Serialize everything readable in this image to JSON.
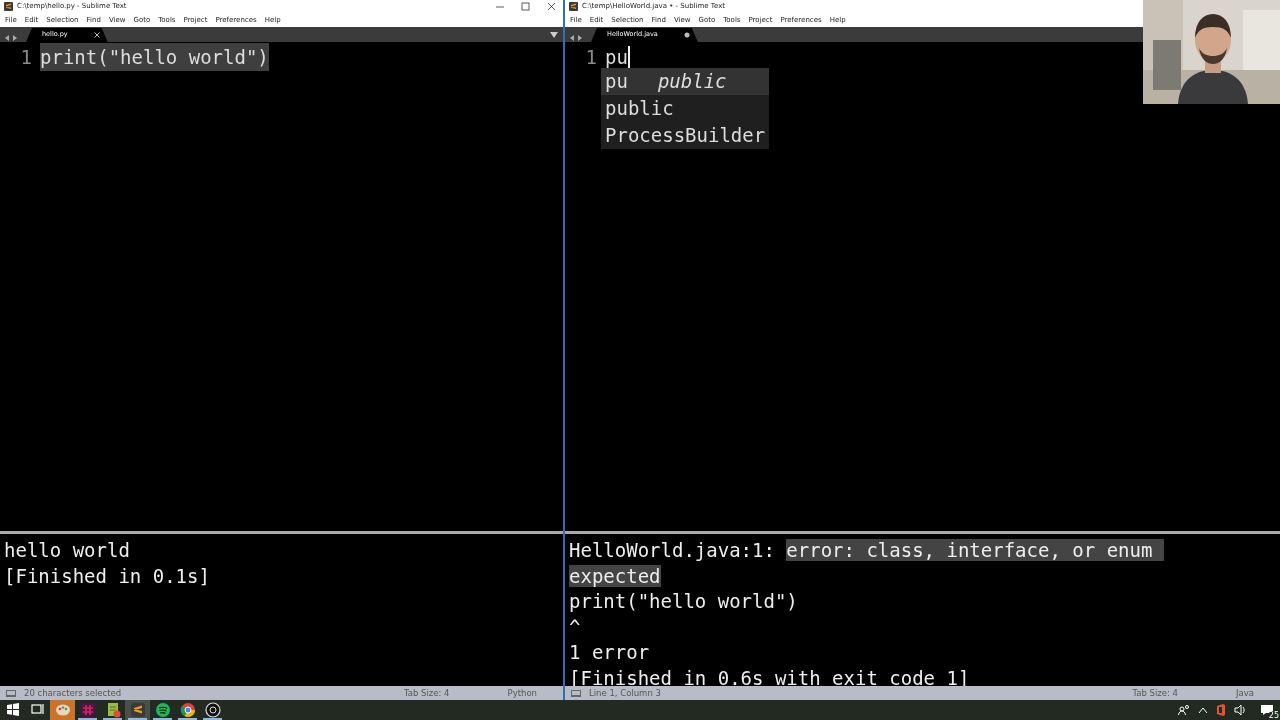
{
  "windows": [
    {
      "title": "C:\\temp\\hello.py - Sublime Text",
      "controls": true,
      "menu": [
        "File",
        "Edit",
        "Selection",
        "Find",
        "View",
        "Goto",
        "Tools",
        "Project",
        "Preferences",
        "Help"
      ],
      "tab": {
        "label": "hello.py",
        "dirty": false
      },
      "tab_menu": true,
      "lines": [
        {
          "number": "1",
          "text": "print(\"hello world\")",
          "selected": true,
          "cursor": false
        }
      ],
      "output": [
        {
          "segments": [
            {
              "text": "hello world",
              "highlighted": false
            }
          ]
        },
        {
          "segments": [
            {
              "text": "[Finished in 0.1s]",
              "highlighted": false
            }
          ]
        }
      ],
      "status": {
        "message": "20 characters selected",
        "tab_size": "Tab Size: 4",
        "syntax": "Python"
      }
    },
    {
      "title": "C:\\temp\\HelloWorld.java • - Sublime Text",
      "controls": false,
      "menu": [
        "File",
        "Edit",
        "Selection",
        "Find",
        "View",
        "Goto",
        "Tools",
        "Project",
        "Preferences",
        "Help"
      ],
      "tab": {
        "label": "HelloWorld.java",
        "dirty": true
      },
      "tab_menu": false,
      "lines": [
        {
          "number": "1",
          "text": "pu",
          "selected": false,
          "cursor": true
        }
      ],
      "autocomplete": [
        {
          "match": "pu",
          "hint": "public",
          "selected": true
        },
        {
          "match": "public",
          "selected": false
        },
        {
          "match": "ProcessBuilder",
          "selected": false
        }
      ],
      "output": [
        {
          "segments": [
            {
              "text": "HelloWorld.java:1: ",
              "highlighted": false
            },
            {
              "text": "error: class, interface, or enum ",
              "highlighted": true
            }
          ]
        },
        {
          "segments": [
            {
              "text": "expected",
              "highlighted": true
            }
          ]
        },
        {
          "segments": [
            {
              "text": "print(\"hello world\")",
              "highlighted": false
            }
          ]
        },
        {
          "segments": [
            {
              "text": "^",
              "highlighted": false
            }
          ]
        },
        {
          "segments": [
            {
              "text": "1 error",
              "highlighted": false
            }
          ]
        },
        {
          "segments": [
            {
              "text": "[Finished in 0.6s with exit code 1]",
              "highlighted": false
            }
          ]
        }
      ],
      "status": {
        "message": "Line 1, Column 3",
        "tab_size": "Tab Size: 4",
        "syntax": "Java"
      }
    }
  ],
  "taskbar": {
    "apps": [
      {
        "kind": "start",
        "open": false,
        "selected": false,
        "attention": false
      },
      {
        "kind": "taskview",
        "open": false,
        "selected": false,
        "attention": false
      },
      {
        "kind": "palette",
        "open": false,
        "selected": false,
        "attention": true
      },
      {
        "kind": "hash",
        "open": true,
        "selected": false,
        "attention": false
      },
      {
        "kind": "document",
        "open": true,
        "selected": false,
        "attention": false
      },
      {
        "kind": "editor",
        "open": true,
        "selected": true,
        "attention": false
      },
      {
        "kind": "music",
        "open": true,
        "selected": false,
        "attention": false
      },
      {
        "kind": "browser",
        "open": true,
        "selected": false,
        "attention": false
      },
      {
        "kind": "camera",
        "open": true,
        "selected": false,
        "attention": false
      }
    ],
    "notifications": "25"
  }
}
